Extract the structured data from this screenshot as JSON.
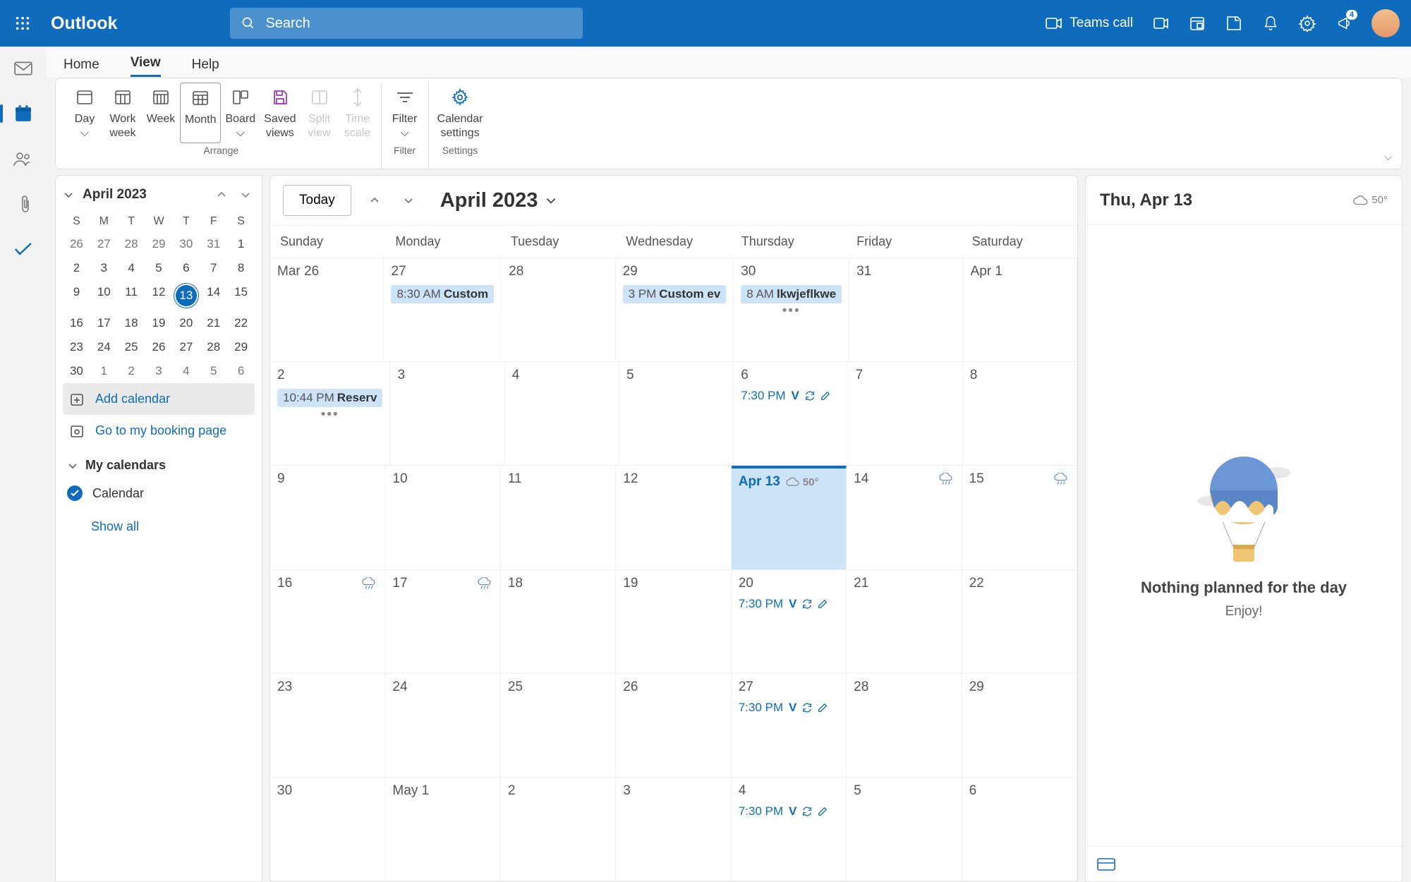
{
  "app": {
    "name": "Outlook",
    "search_placeholder": "Search"
  },
  "top_actions": {
    "teams_call": "Teams call",
    "badge": "4"
  },
  "ribbon_tabs": [
    "Home",
    "View",
    "Help"
  ],
  "ribbon_active_index": 1,
  "ribbon": {
    "arrange": {
      "label": "Arrange",
      "day": "Day",
      "work_week_1": "Work",
      "work_week_2": "week",
      "week": "Week",
      "month": "Month",
      "board": "Board",
      "saved_1": "Saved",
      "saved_2": "views",
      "split_1": "Split",
      "split_2": "view",
      "time_1": "Time",
      "time_2": "scale"
    },
    "filter": {
      "label": "Filter",
      "btn": "Filter"
    },
    "settings": {
      "label": "Settings",
      "btn_1": "Calendar",
      "btn_2": "settings"
    }
  },
  "mini": {
    "title": "April 2023",
    "dows": [
      "S",
      "M",
      "T",
      "W",
      "T",
      "F",
      "S"
    ],
    "rows": [
      [
        {
          "n": "26"
        },
        {
          "n": "27"
        },
        {
          "n": "28"
        },
        {
          "n": "29"
        },
        {
          "n": "30"
        },
        {
          "n": "31"
        },
        {
          "n": "1",
          "mo": true
        }
      ],
      [
        {
          "n": "2",
          "mo": true
        },
        {
          "n": "3",
          "mo": true
        },
        {
          "n": "4",
          "mo": true
        },
        {
          "n": "5",
          "mo": true
        },
        {
          "n": "6",
          "mo": true
        },
        {
          "n": "7",
          "mo": true
        },
        {
          "n": "8",
          "mo": true
        }
      ],
      [
        {
          "n": "9",
          "mo": true
        },
        {
          "n": "10",
          "mo": true
        },
        {
          "n": "11",
          "mo": true
        },
        {
          "n": "12",
          "mo": true
        },
        {
          "n": "13",
          "mo": true,
          "today": true
        },
        {
          "n": "14",
          "mo": true
        },
        {
          "n": "15",
          "mo": true
        }
      ],
      [
        {
          "n": "16",
          "mo": true
        },
        {
          "n": "17",
          "mo": true
        },
        {
          "n": "18",
          "mo": true
        },
        {
          "n": "19",
          "mo": true
        },
        {
          "n": "20",
          "mo": true
        },
        {
          "n": "21",
          "mo": true
        },
        {
          "n": "22",
          "mo": true
        }
      ],
      [
        {
          "n": "23",
          "mo": true
        },
        {
          "n": "24",
          "mo": true
        },
        {
          "n": "25",
          "mo": true
        },
        {
          "n": "26",
          "mo": true
        },
        {
          "n": "27",
          "mo": true
        },
        {
          "n": "28",
          "mo": true
        },
        {
          "n": "29",
          "mo": true
        }
      ],
      [
        {
          "n": "30",
          "mo": true
        },
        {
          "n": "1"
        },
        {
          "n": "2"
        },
        {
          "n": "3"
        },
        {
          "n": "4"
        },
        {
          "n": "5"
        },
        {
          "n": "6"
        }
      ]
    ]
  },
  "side": {
    "add_calendar": "Add calendar",
    "booking": "Go to my booking page",
    "my_calendars": "My calendars",
    "calendar_item": "Calendar",
    "show_all": "Show all"
  },
  "cal": {
    "today": "Today",
    "title": "April 2023",
    "dows": [
      "Sunday",
      "Monday",
      "Tuesday",
      "Wednesday",
      "Thursday",
      "Friday",
      "Saturday"
    ],
    "weeks": [
      [
        {
          "label": "Mar 26"
        },
        {
          "label": "27",
          "ev": [
            {
              "t": "8:30 AM",
              "n": "Custom"
            }
          ]
        },
        {
          "label": "28"
        },
        {
          "label": "29",
          "ev": [
            {
              "t": "3 PM",
              "n": "Custom ev"
            }
          ]
        },
        {
          "label": "30",
          "ev": [
            {
              "t": "8 AM",
              "n": "lkwjeflkwe"
            }
          ],
          "more": true
        },
        {
          "label": "31"
        },
        {
          "label": "Apr 1"
        }
      ],
      [
        {
          "label": "2",
          "ev": [
            {
              "t": "10:44 PM",
              "n": "Reserv"
            }
          ],
          "more": true
        },
        {
          "label": "3"
        },
        {
          "label": "4"
        },
        {
          "label": "5"
        },
        {
          "label": "6",
          "ev2": [
            {
              "t": "7:30 PM",
              "n": "V"
            }
          ]
        },
        {
          "label": "7"
        },
        {
          "label": "8"
        }
      ],
      [
        {
          "label": "9"
        },
        {
          "label": "10"
        },
        {
          "label": "11"
        },
        {
          "label": "12"
        },
        {
          "label": "Apr 13",
          "today": true,
          "weather": "50°"
        },
        {
          "label": "14",
          "wico": true
        },
        {
          "label": "15",
          "wico": true
        }
      ],
      [
        {
          "label": "16",
          "wico": true
        },
        {
          "label": "17",
          "wico": true
        },
        {
          "label": "18"
        },
        {
          "label": "19"
        },
        {
          "label": "20",
          "ev2": [
            {
              "t": "7:30 PM",
              "n": "V"
            }
          ]
        },
        {
          "label": "21"
        },
        {
          "label": "22"
        }
      ],
      [
        {
          "label": "23"
        },
        {
          "label": "24"
        },
        {
          "label": "25"
        },
        {
          "label": "26"
        },
        {
          "label": "27",
          "ev2": [
            {
              "t": "7:30 PM",
              "n": "V"
            }
          ]
        },
        {
          "label": "28"
        },
        {
          "label": "29"
        }
      ],
      [
        {
          "label": "30"
        },
        {
          "label": "May 1"
        },
        {
          "label": "2"
        },
        {
          "label": "3"
        },
        {
          "label": "4",
          "ev2": [
            {
              "t": "7:30 PM",
              "n": "V"
            }
          ]
        },
        {
          "label": "5"
        },
        {
          "label": "6"
        }
      ]
    ]
  },
  "detail": {
    "title": "Thu, Apr 13",
    "temp": "50°",
    "empty_title": "Nothing planned for the day",
    "empty_sub": "Enjoy!"
  },
  "colors": {
    "accent": "#0f6cbd"
  }
}
